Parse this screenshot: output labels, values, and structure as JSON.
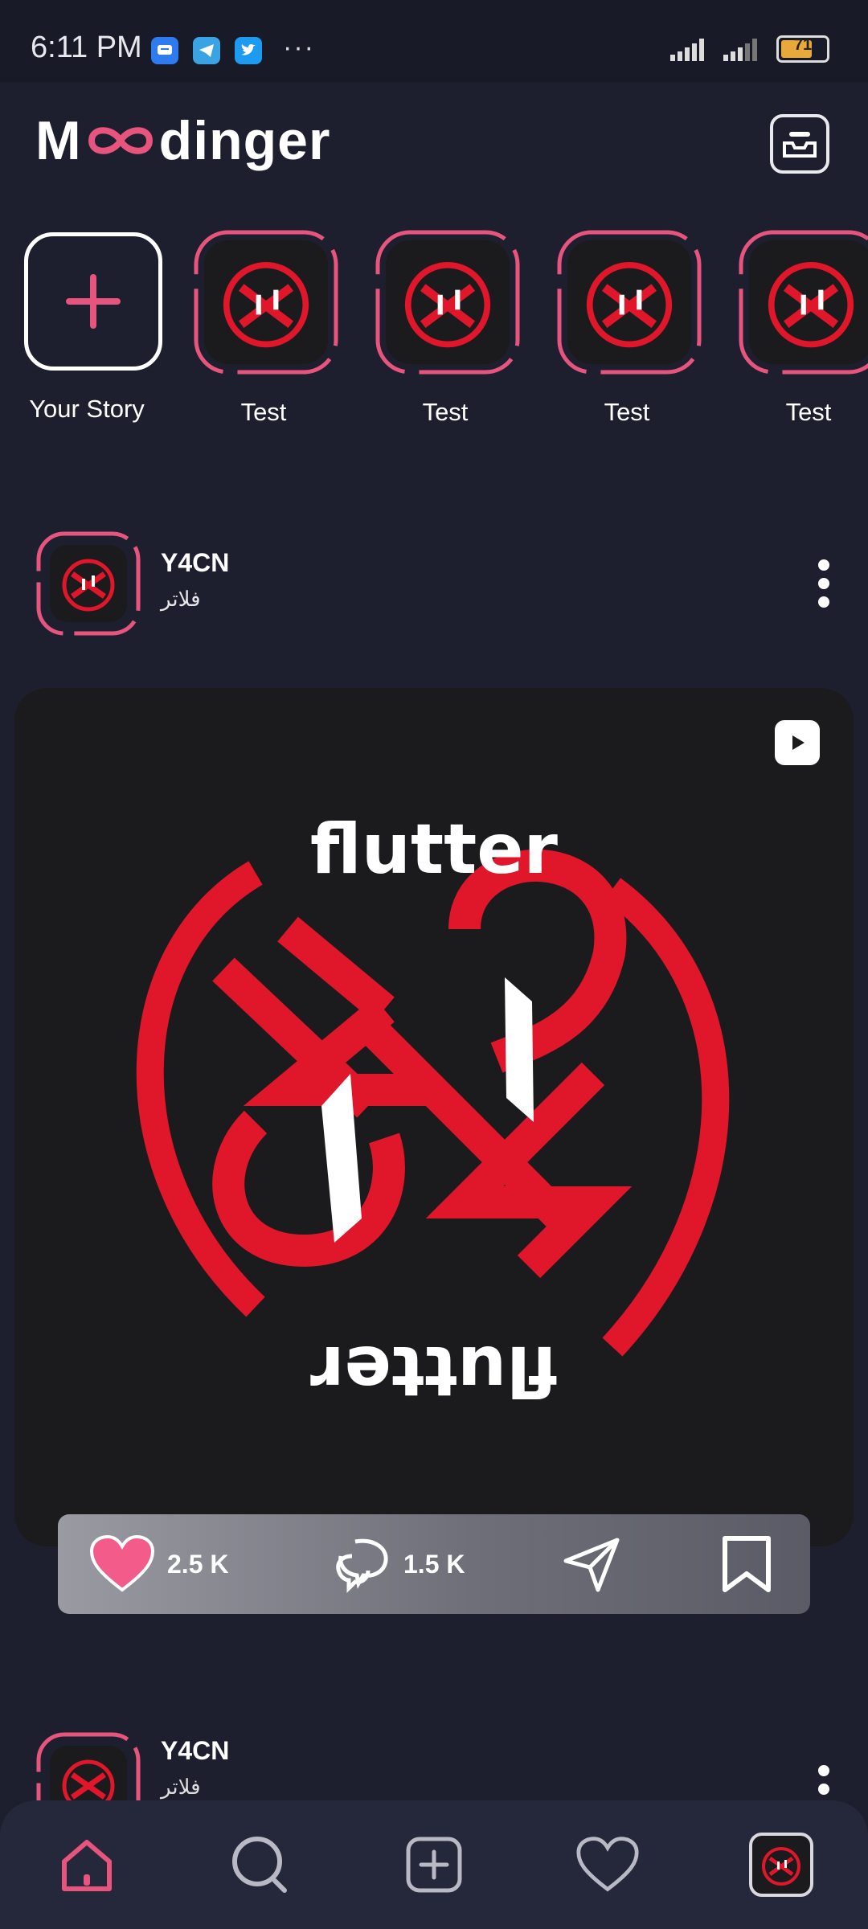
{
  "status_bar": {
    "time": "6:11 PM",
    "notification_icons": [
      "messages-icon",
      "telegram-icon",
      "twitter-icon"
    ],
    "more": "···",
    "battery": "71"
  },
  "header": {
    "brand_left": "M",
    "brand_right": "dinger",
    "inbox_icon": "inbox-icon"
  },
  "stories": [
    {
      "label": "Your Story",
      "type": "add"
    },
    {
      "label": "Test"
    },
    {
      "label": "Test"
    },
    {
      "label": "Test"
    },
    {
      "label": "Test"
    }
  ],
  "post": {
    "username": "Y4CN",
    "subtitle": "فلاتر",
    "logo_text": "flutter",
    "likes": "2.5 K",
    "comments": "1.5 K"
  },
  "post2": {
    "username": "Y4CN",
    "subtitle": "فلاتر"
  },
  "bottom_nav": [
    "home-icon",
    "search-icon",
    "add-post-icon",
    "heart-icon",
    "profile-avatar"
  ],
  "colors": {
    "background": "#1e1f2e",
    "accent": "#e7547d",
    "logo_red": "#e0162b"
  }
}
